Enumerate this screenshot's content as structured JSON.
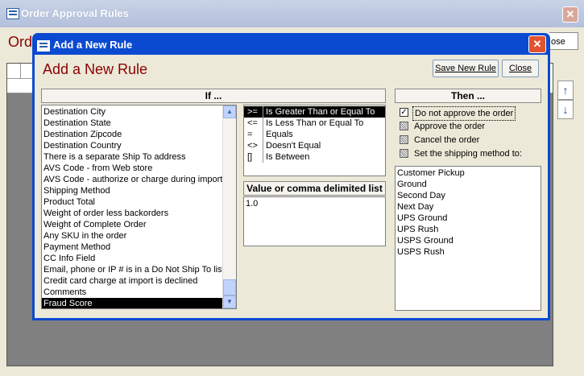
{
  "parent": {
    "title": "Order Approval Rules",
    "heading_partial": "Ord",
    "close_partial": "ose",
    "up_arrow": "↑",
    "down_arrow": "↓"
  },
  "dialog": {
    "title": "Add a New Rule",
    "heading": "Add a New Rule",
    "save_button": "Save New Rule",
    "close_button": "Close",
    "if_header": "If ...",
    "then_header": "Then ...",
    "value_header": "Value or comma delimited list",
    "value_items": [
      "1.0"
    ],
    "fields": [
      "Destination City",
      "Destination State",
      "Destination Zipcode",
      "Destination Country",
      "There is a separate Ship To address",
      "AVS Code - from Web store",
      "AVS Code - authorize or charge during import",
      "Shipping Method",
      "Product Total",
      "Weight of order less backorders",
      "Weight of Complete Order",
      "Any SKU in the order",
      "Payment Method",
      "CC Info Field",
      "Email, phone or IP # is in a Do Not Ship To list",
      "Credit card charge at import is declined",
      "Comments",
      "Fraud Score"
    ],
    "selected_field": "Fraud Score",
    "operators": [
      {
        "symbol": ">=",
        "label": "Is Greater Than or Equal To",
        "selected": true
      },
      {
        "symbol": "<=",
        "label": "Is Less Than or Equal To",
        "selected": false
      },
      {
        "symbol": "=",
        "label": "Equals",
        "selected": false
      },
      {
        "symbol": "<>",
        "label": "Doesn't Equal",
        "selected": false
      },
      {
        "symbol": "[]",
        "label": "Is Between",
        "selected": false
      }
    ],
    "actions": [
      {
        "label": "Do not approve the order",
        "state": "checked"
      },
      {
        "label": "Approve the order",
        "state": "indeterminate"
      },
      {
        "label": "Cancel the order",
        "state": "indeterminate"
      },
      {
        "label": "Set the shipping method to:",
        "state": "indeterminate"
      }
    ],
    "shipping_methods": [
      "Customer Pickup",
      "Ground",
      "Second Day",
      "Next Day",
      "UPS Ground",
      "UPS Rush",
      "USPS Ground",
      "USPS Rush"
    ],
    "check_mark": "✓",
    "close_glyph": "✕",
    "scroll_up": "▲",
    "scroll_down": "▼"
  }
}
